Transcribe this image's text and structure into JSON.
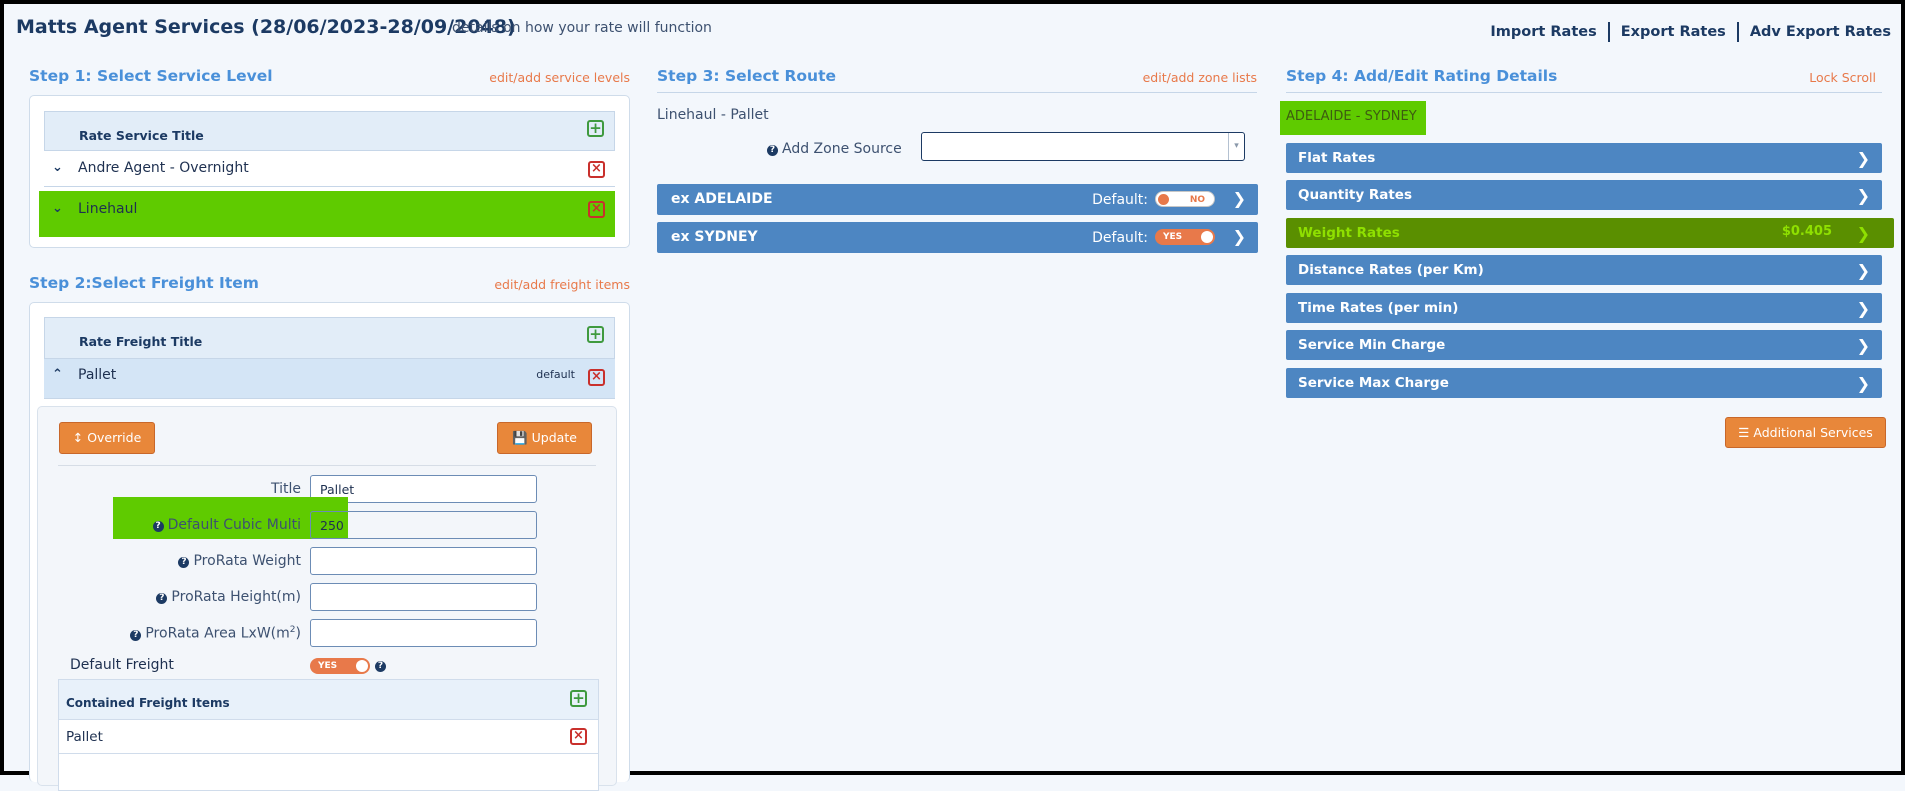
{
  "header": {
    "title": "Matts Agent Services (28/06/2023-28/09/2048)",
    "subtitle": "details on how your rate will function",
    "links": [
      "Import Rates",
      "Export Rates",
      "Adv Export Rates"
    ]
  },
  "step1": {
    "title": "Step 1: Select Service Level",
    "link": "edit/add service levels",
    "table_header": "Rate Service Title",
    "rows": [
      {
        "label": "Andre Agent - Overnight"
      },
      {
        "label": "Linehaul"
      }
    ]
  },
  "step2": {
    "title": "Step 2:Select Freight Item",
    "link": "edit/add freight items",
    "table_header": "Rate Freight Title",
    "row": {
      "label": "Pallet",
      "badge": "default"
    },
    "override_label": "Override",
    "update_label": "Update",
    "fields": {
      "title_label": "Title",
      "title_value": "Pallet",
      "cubic_label": "Default Cubic Multi",
      "cubic_value": "250",
      "prorata_weight_label": "ProRata Weight",
      "prorata_height_label": "ProRata Height(m)",
      "prorata_area_label": "ProRata Area LxW(m",
      "prorata_area_sup": "2",
      "prorata_area_close": ")",
      "default_freight_label": "Default Freight",
      "default_freight_toggle": "YES"
    },
    "contained": {
      "header": "Contained Freight Items",
      "items": [
        "Pallet"
      ]
    }
  },
  "step3": {
    "title": "Step 3: Select Route",
    "link": "edit/add zone lists",
    "route_name": "Linehaul - Pallet",
    "zone_source_label": "Add Zone Source",
    "zone_source_value": "",
    "routes": [
      {
        "label": "ex ADELAIDE",
        "default_label": "Default:",
        "toggle": "NO"
      },
      {
        "label": "ex SYDNEY",
        "default_label": "Default:",
        "toggle": "YES"
      }
    ]
  },
  "step4": {
    "title": "Step 4: Add/Edit Rating Details",
    "link": "Lock Scroll",
    "route_tag": "ADELAIDE - SYDNEY",
    "rates": [
      {
        "label": "Flat Rates",
        "value": ""
      },
      {
        "label": "Quantity Rates",
        "value": ""
      },
      {
        "label": "Weight Rates",
        "value": "$0.405"
      },
      {
        "label": "Distance Rates (per Km)",
        "value": ""
      },
      {
        "label": "Time Rates (per min)",
        "value": ""
      },
      {
        "label": "Service Min Charge",
        "value": ""
      },
      {
        "label": "Service Max Charge",
        "value": ""
      }
    ],
    "additional_services_label": "Additional Services"
  },
  "colors": {
    "accent_blue": "#4a90d9",
    "bar_blue": "#4d86c2",
    "orange": "#e8873a",
    "highlight_green": "#5fcb00",
    "weight_rates_bg": "#5a8f00",
    "weight_rates_text": "#8fe000"
  }
}
